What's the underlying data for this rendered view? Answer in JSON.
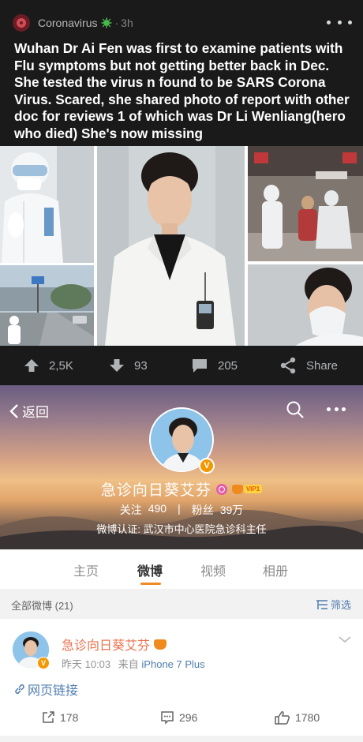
{
  "reddit": {
    "subreddit": "Coronavirus",
    "separator": "·",
    "time": "3h",
    "title": "Wuhan Dr Ai Fen was first to examine patients with Flu symptoms but not getting better back in Dec. She tested the virus n found to be SARS Corona Virus. Scared, she shared photo of report with other doc for reviews 1 of which was Dr Li Wenliang(hero who died) She's now missing",
    "upvotes": "2,5K",
    "downvotes": "93",
    "comments": "205",
    "share_label": "Share",
    "icons": [
      "subreddit-avatar-icon",
      "virus-flair-icon",
      "more-dots-icon",
      "upvote-icon",
      "downvote-icon",
      "comment-icon",
      "share-icon"
    ]
  },
  "weibo": {
    "back_label": "返回",
    "profile_name": "急诊向日葵艾芬",
    "vip_label": "VIP1",
    "verify_badge": "V",
    "follow_label": "关注",
    "follow_count": "490",
    "stat_divider": "|",
    "fans_label": "粉丝",
    "fans_count": "39万",
    "verification": "微博认证: 武汉市中心医院急诊科主任",
    "tabs": [
      "主页",
      "微博",
      "视频",
      "相册"
    ],
    "active_tab": "微博",
    "all_posts": "全部微博 (21)",
    "filter_label": "筛选",
    "post": {
      "author": "急诊向日葵艾芬",
      "time": "昨天 10:03",
      "source_prefix": "来自",
      "source": "iPhone 7 Plus",
      "link_text": "网页链接",
      "reposts": "178",
      "comments": "296",
      "likes": "1780"
    },
    "colors": {
      "accent": "#f08a24",
      "link": "#507daf",
      "name": "#eb7350",
      "verify": "#f39800"
    }
  }
}
